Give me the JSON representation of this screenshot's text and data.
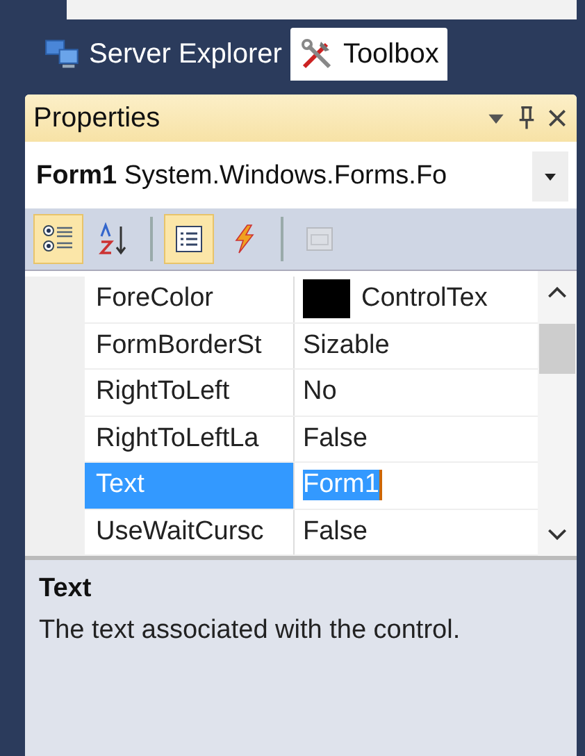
{
  "tabs": [
    {
      "label": "Server Explorer",
      "kind": "server",
      "selected": false
    },
    {
      "label": "Toolbox",
      "kind": "toolbox",
      "selected": true
    }
  ],
  "panel": {
    "title": "Properties"
  },
  "object_selector": {
    "name": "Form1",
    "type": "System.Windows.Forms.Fo"
  },
  "toolbar": [
    {
      "kind": "categorized",
      "selected": true,
      "disabled": false
    },
    {
      "kind": "alphabetical",
      "selected": false,
      "disabled": false
    },
    {
      "kind": "separator"
    },
    {
      "kind": "properties",
      "selected": true,
      "disabled": false
    },
    {
      "kind": "events",
      "selected": false,
      "disabled": false
    },
    {
      "kind": "separator"
    },
    {
      "kind": "pages",
      "selected": false,
      "disabled": true
    }
  ],
  "grid": {
    "rows": [
      {
        "name": "ForeColor",
        "value": "ControlTex",
        "color": "#000000",
        "selected": false
      },
      {
        "name": "FormBorderSt",
        "value": "Sizable",
        "selected": false
      },
      {
        "name": "RightToLeft",
        "value": "No",
        "selected": false
      },
      {
        "name": "RightToLeftLa",
        "value": "False",
        "selected": false
      },
      {
        "name": "Text",
        "value": "Form1",
        "selected": true
      },
      {
        "name": "UseWaitCursc",
        "value": "False",
        "selected": false
      }
    ]
  },
  "description": {
    "title": "Text",
    "text": "The text associated with the control."
  }
}
